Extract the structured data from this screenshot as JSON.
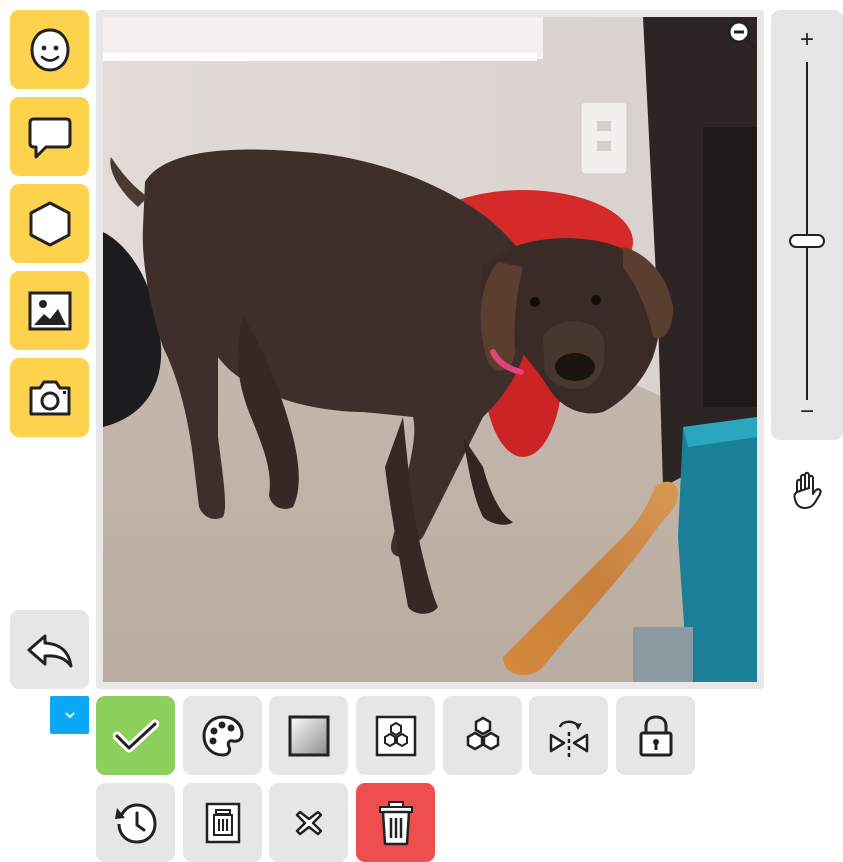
{
  "left_toolbar": {
    "items": [
      {
        "name": "emoji",
        "icon": "smiley-face-icon"
      },
      {
        "name": "speech-bubble",
        "icon": "speech-bubble-icon"
      },
      {
        "name": "shape",
        "icon": "hexagon-icon"
      },
      {
        "name": "image",
        "icon": "image-icon"
      },
      {
        "name": "camera",
        "icon": "camera-icon"
      }
    ],
    "undo_icon": "undo-arrow-icon"
  },
  "zoom": {
    "plus_label": "+",
    "minus_label": "−",
    "level": 0.47,
    "zoom_out_icon": "zoom-out-icon",
    "pan_icon": "pan-hand-icon"
  },
  "bottom_toolbar": {
    "dropdown_icon": "chevron-down-icon",
    "row1": [
      "confirm-check-icon",
      "palette-icon",
      "gradient-square-icon",
      "hexagon-frame-icon",
      "hexagon-cluster-icon",
      "flip-horizontal-icon",
      "lock-icon"
    ],
    "row2": [
      "history-icon",
      "delete-layer-icon",
      "close-x-icon",
      "trash-icon"
    ]
  },
  "colors": {
    "accent_yellow": "#fdd34d",
    "confirm_green": "#8ccf5c",
    "delete_red": "#ef4e4e",
    "dropdown_blue": "#0aa8f5",
    "button_gray": "#e6e6e6"
  }
}
